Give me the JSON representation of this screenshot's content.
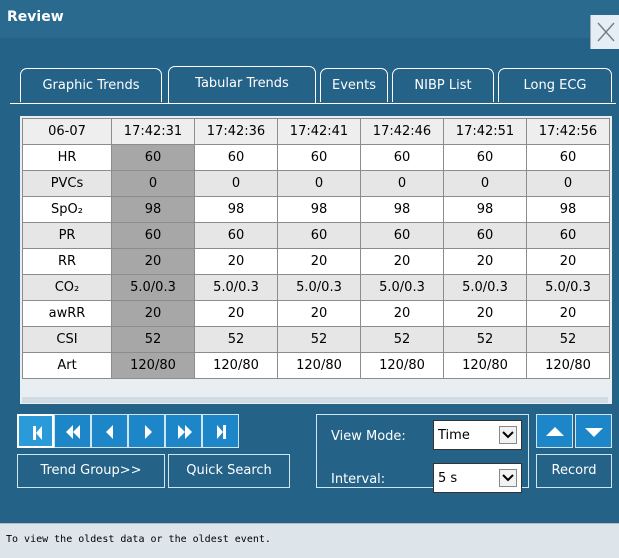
{
  "window": {
    "title": "Review"
  },
  "tabs": [
    {
      "label": "Graphic Trends",
      "active": false
    },
    {
      "label": "Tabular Trends",
      "active": true
    },
    {
      "label": "Events",
      "active": false
    },
    {
      "label": "NIBP List",
      "active": false
    },
    {
      "label": "Long ECG",
      "active": false
    }
  ],
  "table": {
    "header": [
      "06-07",
      "17:42:31",
      "17:42:36",
      "17:42:41",
      "17:42:46",
      "17:42:51",
      "17:42:56"
    ],
    "rows": [
      {
        "label": "HR",
        "values": [
          "60",
          "60",
          "60",
          "60",
          "60",
          "60"
        ]
      },
      {
        "label": "PVCs",
        "values": [
          "0",
          "0",
          "0",
          "0",
          "0",
          "0"
        ]
      },
      {
        "label": "SpO₂",
        "values": [
          "98",
          "98",
          "98",
          "98",
          "98",
          "98"
        ]
      },
      {
        "label": "PR",
        "values": [
          "60",
          "60",
          "60",
          "60",
          "60",
          "60"
        ]
      },
      {
        "label": "RR",
        "values": [
          "20",
          "20",
          "20",
          "20",
          "20",
          "20"
        ]
      },
      {
        "label": "CO₂",
        "values": [
          "5.0/0.3",
          "5.0/0.3",
          "5.0/0.3",
          "5.0/0.3",
          "5.0/0.3",
          "5.0/0.3"
        ]
      },
      {
        "label": "awRR",
        "values": [
          "20",
          "20",
          "20",
          "20",
          "20",
          "20"
        ]
      },
      {
        "label": "CSI",
        "values": [
          "52",
          "52",
          "52",
          "52",
          "52",
          "52"
        ]
      },
      {
        "label": "Art",
        "values": [
          "120/80",
          "120/80",
          "120/80",
          "120/80",
          "120/80",
          "120/80"
        ]
      }
    ]
  },
  "controls": {
    "trend_group_label": "Trend Group>>",
    "quick_search_label": "Quick Search",
    "view_mode_label": "View Mode:",
    "view_mode_value": "Time",
    "interval_label": "Interval:",
    "interval_value": "5 s",
    "record_label": "Record"
  },
  "status": {
    "text": "To view the oldest data or the oldest event."
  },
  "colors": {
    "window_bg": "#246288",
    "button_blue": "#1d86c8",
    "selected_column": "#a7a7a7"
  }
}
